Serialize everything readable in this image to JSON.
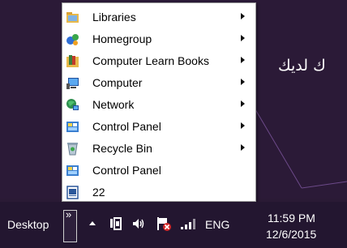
{
  "desktop_background": {
    "partial_text": "ك لديك"
  },
  "menu": {
    "items": [
      {
        "label": "Libraries",
        "icon": "libraries-icon",
        "has_submenu": true
      },
      {
        "label": "Homegroup",
        "icon": "homegroup-icon",
        "has_submenu": true
      },
      {
        "label": "Computer Learn Books",
        "icon": "books-folder-icon",
        "has_submenu": true
      },
      {
        "label": "Computer",
        "icon": "computer-icon",
        "has_submenu": true
      },
      {
        "label": "Network",
        "icon": "network-icon",
        "has_submenu": true
      },
      {
        "label": "Control Panel",
        "icon": "control-panel-icon",
        "has_submenu": true
      },
      {
        "label": "Recycle Bin",
        "icon": "recycle-bin-icon",
        "has_submenu": true
      },
      {
        "label": "Control Panel",
        "icon": "control-panel-icon",
        "has_submenu": false
      },
      {
        "label": "22",
        "icon": "word-document-icon",
        "has_submenu": false
      }
    ]
  },
  "taskbar": {
    "toolbar_label": "Desktop",
    "chevron": "»",
    "language": "ENG",
    "time": "11:59 PM",
    "date": "12/6/2015"
  }
}
